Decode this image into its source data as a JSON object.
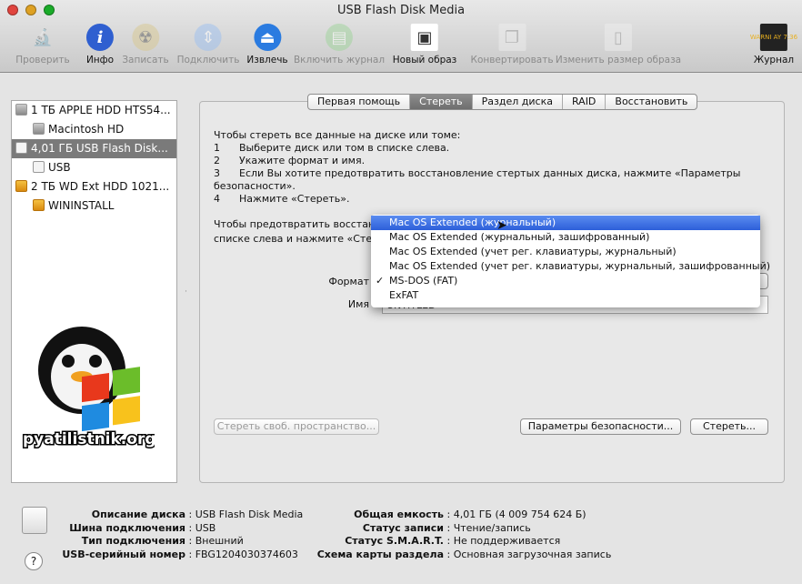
{
  "window": {
    "title": "USB Flash Disk Media"
  },
  "toolbar": [
    {
      "label": "Проверить",
      "icon": "microscope-icon",
      "enabled": false
    },
    {
      "label": "Инфо",
      "icon": "info-icon",
      "enabled": true
    },
    {
      "label": "Записать",
      "icon": "burn-icon",
      "enabled": false
    },
    {
      "label": "Подключить",
      "icon": "mount-icon",
      "enabled": false
    },
    {
      "label": "Извлечь",
      "icon": "eject-icon",
      "enabled": true
    },
    {
      "label": "Включить журнал",
      "icon": "journal-icon",
      "enabled": false
    },
    {
      "label": "Новый образ",
      "icon": "new-image-icon",
      "enabled": true
    },
    {
      "label": "Конвертировать",
      "icon": "convert-icon",
      "enabled": false
    },
    {
      "label": "Изменить размер образа",
      "icon": "resize-image-icon",
      "enabled": false
    },
    {
      "label": "Журнал",
      "icon": "log-icon",
      "enabled": true
    }
  ],
  "log_icon_text": "WARNI AY 7:36",
  "sidebar": [
    {
      "label": "1 ТБ APPLE HDD HTS54...",
      "type": "hdd",
      "level": 0
    },
    {
      "label": "Macintosh HD",
      "type": "hdd",
      "level": 1
    },
    {
      "label": "4,01 ГБ USB Flash Disk...",
      "type": "usb",
      "level": 0,
      "selected": true
    },
    {
      "label": "USB",
      "type": "usb",
      "level": 1
    },
    {
      "label": "2 ТБ WD Ext HDD 1021...",
      "type": "ext",
      "level": 0
    },
    {
      "label": "WININSTALL",
      "type": "ext",
      "level": 1
    }
  ],
  "tabs": [
    "Первая помощь",
    "Стереть",
    "Раздел диска",
    "RAID",
    "Восстановить"
  ],
  "active_tab": "Стереть",
  "instructions": {
    "intro": "Чтобы стереть все данные на диске или томе:",
    "steps": [
      {
        "n": "1",
        "text": "Выберите диск или том в списке слева."
      },
      {
        "n": "2",
        "text": "Укажите формат и имя."
      },
      {
        "n": "3",
        "text": "Если Вы хотите предотвратить восстановление стертых данных диска, нажмите «Параметры"
      },
      {
        "n": "4",
        "text": "Нажмите «Стереть»."
      }
    ],
    "step3_cont": "безопасности».",
    "note1": "Чтобы предотвратить восстано",
    "note2": "списке слева и нажмите «Стере"
  },
  "form": {
    "format_label": "Формат",
    "name_label": "Имя",
    "name_value": "UNTITLED"
  },
  "format_menu": [
    {
      "label": "Mac OS Extended (журнальный)",
      "highlighted": true
    },
    {
      "label": "Mac OS Extended (журнальный, зашифрованный)"
    },
    {
      "label": "Mac OS Extended (учет рег. клавиатуры, журнальный)"
    },
    {
      "label": "Mac OS Extended (учет рег. клавиатуры, журнальный, зашифрованный)"
    },
    {
      "label": "MS-DOS (FAT)",
      "checked": true
    },
    {
      "label": "ExFAT"
    }
  ],
  "check_mark": "✓",
  "buttons": {
    "erase_free": "Стереть своб. пространство...",
    "security": "Параметры безопасности...",
    "erase": "Стереть..."
  },
  "info_left": [
    {
      "label": "Описание диска",
      "value": "USB Flash Disk Media"
    },
    {
      "label": "Шина подключения",
      "value": "USB"
    },
    {
      "label": "Тип подключения",
      "value": "Внешний"
    },
    {
      "label": "USB-серийный номер",
      "value": "FBG1204030374603"
    }
  ],
  "info_right": [
    {
      "label": "Общая емкость",
      "value": "4,01 ГБ (4 009 754 624 Б)"
    },
    {
      "label": "Статус записи",
      "value": "Чтение/запись"
    },
    {
      "label": "Статус S.M.A.R.T.",
      "value": "Не поддерживается"
    },
    {
      "label": "Схема карты раздела",
      "value": "Основная загрузочная запись"
    }
  ],
  "help": "?",
  "watermark": "pyatilistnik.org"
}
